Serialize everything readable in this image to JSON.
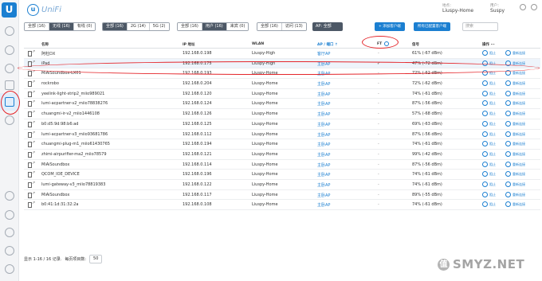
{
  "sidebar": {
    "logo_text": "U"
  },
  "header": {
    "brand_mark": "u",
    "brand_name": "UniFi",
    "site_label": "地点：",
    "site_value": "Liuspy-Home",
    "user_label": "用户：",
    "user_value": "Suspy"
  },
  "filters": {
    "group1": [
      "全部 (16)",
      "无线 (16)",
      "有线 (0)"
    ],
    "group2": [
      "全部 (16)",
      "2G (14)",
      "5G (2)"
    ],
    "group3": [
      "全部 (16)",
      "用户 (16)",
      "来宾 (0)"
    ],
    "group4": [
      "全部 (16)",
      "访问 (13)"
    ],
    "ap_select": "AP: 全部",
    "btn_add_client": "+ 添加客户端",
    "btn_configured": "所有已配置客户端",
    "search_placeholder": "搜索"
  },
  "table": {
    "headers": {
      "name": "名称",
      "ip": "IP 地址",
      "wlan": "WLAN",
      "ap": "AP / 端口 ↑",
      "ft": "FT",
      "signal": "信号",
      "actions": "操作 ···"
    },
    "action_block": "阻止",
    "action_reconnect": "重新连接",
    "rows": [
      {
        "name": "阿杜DX",
        "ip": "192.168.0.198",
        "wlan": "Liuspy-High",
        "ap": "客厅AP",
        "ft": "-",
        "signal": "61% (-67 dBm)"
      },
      {
        "name": "            iPad",
        "ip": "192.168.0.175",
        "wlan": "Liuspy-High",
        "ap": "主卧AP",
        "ft": "✓",
        "signal": "47% (-72 dBm)"
      },
      {
        "name": "MiAiSoundbox-LX01",
        "ip": "192.168.0.193",
        "wlan": "Liuspy-Home",
        "ap": "主卧AP",
        "ft": "-",
        "signal": "72% (-62 dBm)"
      },
      {
        "name": "rockrobo",
        "ip": "192.168.0.204",
        "wlan": "Liuspy-Home",
        "ap": "主卧AP",
        "ft": "-",
        "signal": "72% (-62 dBm)"
      },
      {
        "name": "yeelink-light-strip2_miio989021",
        "ip": "192.168.0.120",
        "wlan": "Liuspy-Home",
        "ap": "主卧AP",
        "ft": "-",
        "signal": "74% (-61 dBm)"
      },
      {
        "name": "lumi-acpartner-v2_miio78838276",
        "ip": "192.168.0.124",
        "wlan": "Liuspy-Home",
        "ap": "主卧AP",
        "ft": "-",
        "signal": "87% (-56 dBm)"
      },
      {
        "name": "chuangmi-ir-v2_miio1446108",
        "ip": "192.168.0.126",
        "wlan": "Liuspy-Home",
        "ap": "主卧AP",
        "ft": "-",
        "signal": "57% (-68 dBm)"
      },
      {
        "name": "b0:d5:9d:98:b6:ad",
        "ip": "192.168.0.125",
        "wlan": "Liuspy-Home",
        "ap": "主卧AP",
        "ft": "-",
        "signal": "69% (-63 dBm)"
      },
      {
        "name": "lumi-acpartner-v3_miio93681786",
        "ip": "192.168.0.112",
        "wlan": "Liuspy-Home",
        "ap": "主卧AP",
        "ft": "-",
        "signal": "87% (-56 dBm)"
      },
      {
        "name": "chuangmi-plug-m1_miio61430765",
        "ip": "192.168.0.194",
        "wlan": "Liuspy-Home",
        "ap": "主卧AP",
        "ft": "-",
        "signal": "74% (-61 dBm)"
      },
      {
        "name": "zhimi-airpurifier-ma2_miio78579",
        "ip": "192.168.0.121",
        "wlan": "Liuspy-Home",
        "ap": "主卧AP",
        "ft": "-",
        "signal": "99% (-42 dBm)"
      },
      {
        "name": "MiAiSoundbox",
        "ip": "192.168.0.114",
        "wlan": "Liuspy-Home",
        "ap": "主卧AP",
        "ft": "-",
        "signal": "87% (-56 dBm)"
      },
      {
        "name": "QCOM_IOE_DEVICE",
        "ip": "192.168.0.196",
        "wlan": "Liuspy-Home",
        "ap": "主卧AP",
        "ft": "-",
        "signal": "74% (-61 dBm)"
      },
      {
        "name": "lumi-gateway-v3_miio78819383",
        "ip": "192.168.0.122",
        "wlan": "Liuspy-Home",
        "ap": "主卧AP",
        "ft": "-",
        "signal": "74% (-61 dBm)"
      },
      {
        "name": "MiAiSoundbox",
        "ip": "192.168.0.117",
        "wlan": "Liuspy-Home",
        "ap": "主卧AP",
        "ft": "-",
        "signal": "89% (-55 dBm)"
      },
      {
        "name": "b0:41:1d:31:32:2a",
        "ip": "192.168.0.108",
        "wlan": "Liuspy-Home",
        "ap": "主卧AP",
        "ft": "-",
        "signal": "74% (-61 dBm)"
      }
    ]
  },
  "footer": {
    "summary": "显示 1-16 / 16 记录.",
    "per_page_label": "每页项目数:",
    "per_page_value": "50"
  },
  "watermark": {
    "badge": "值",
    "text": "SMYZ.NET"
  },
  "colors": {
    "accent": "#1b7fd1",
    "annotation": "#e4262b",
    "dark_segment": "#4d5866"
  }
}
